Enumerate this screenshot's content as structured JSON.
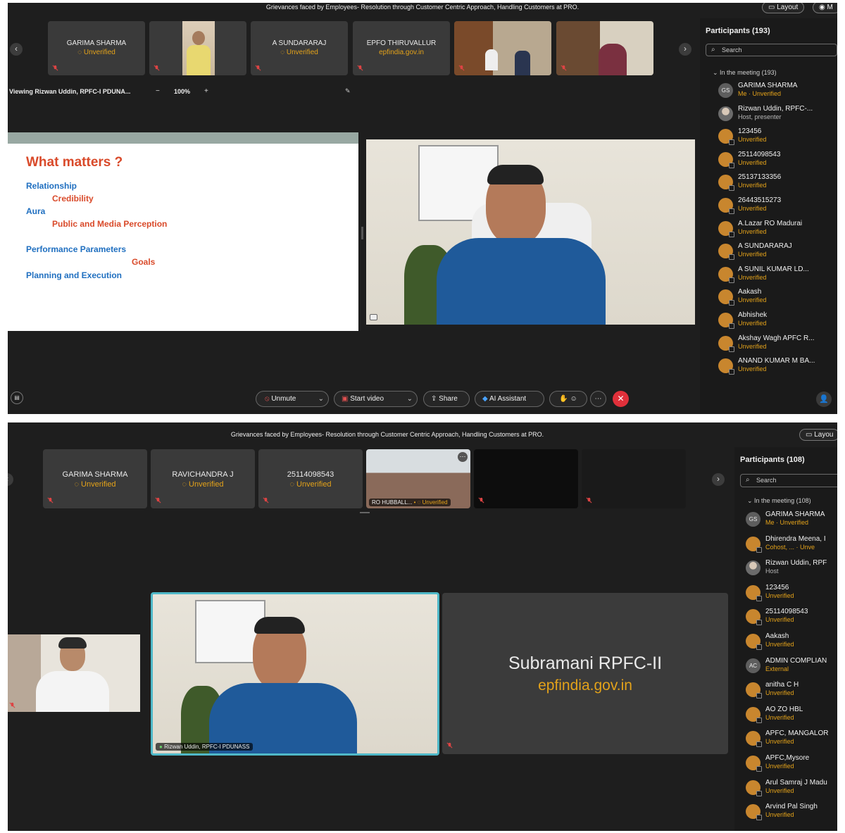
{
  "top": {
    "meeting_title": "Grievances faced by Employees- Resolution through Customer Centric Approach, Handling Customers at PRO.",
    "layout_label": "Layout",
    "tiles": [
      {
        "name": "GARIMA SHARMA",
        "sub": "Unverified"
      },
      {
        "name": "A SUNDARARAJ",
        "sub": "Unverified"
      },
      {
        "name": "EPFO THIRUVALLUR",
        "sub": "epfindia.gov.in"
      }
    ],
    "viewing_label": "Viewing Rizwan Uddin, RPFC-I PDUNA...",
    "zoom_minus": "−",
    "zoom_value": "100%",
    "zoom_plus": "+",
    "slide": {
      "heading": "What matters ?",
      "lines": [
        "Relationship",
        "Credibility",
        "Aura",
        "Public and Media Perception",
        "Performance Parameters",
        "Goals",
        "Planning and Execution"
      ]
    },
    "participants": {
      "title": "Participants (193)",
      "search_placeholder": "Search",
      "group_label": "In the meeting (193)",
      "list": [
        {
          "name": "GARIMA SHARMA",
          "sub": "Me · Unverified",
          "avatar": "GS"
        },
        {
          "name": "Rizwan Uddin, RPFC-...",
          "sub": "Host, presenter",
          "avatar": ""
        },
        {
          "name": "123456",
          "sub": "Unverified",
          "avatar": ""
        },
        {
          "name": "25114098543",
          "sub": "Unverified",
          "avatar": ""
        },
        {
          "name": "25137133356",
          "sub": "Unverified",
          "avatar": ""
        },
        {
          "name": "26443515273",
          "sub": "Unverified",
          "avatar": ""
        },
        {
          "name": "A.Lazar RO Madurai",
          "sub": "Unverified",
          "avatar": ""
        },
        {
          "name": "A SUNDARARAJ",
          "sub": "Unverified",
          "avatar": ""
        },
        {
          "name": "A SUNIL KUMAR LD...",
          "sub": "Unverified",
          "avatar": ""
        },
        {
          "name": "Aakash",
          "sub": "Unverified",
          "avatar": ""
        },
        {
          "name": "Abhishek",
          "sub": "Unverified",
          "avatar": ""
        },
        {
          "name": "Akshay Wagh APFC R...",
          "sub": "Unverified",
          "avatar": ""
        },
        {
          "name": "ANAND KUMAR M BA...",
          "sub": "Unverified",
          "avatar": ""
        }
      ]
    },
    "controls": {
      "unmute": "Unmute",
      "start_video": "Start video",
      "share": "Share",
      "ai_assistant": "AI Assistant"
    }
  },
  "bottom": {
    "meeting_title": "Grievances faced by Employees- Resolution through Customer Centric Approach, Handling Customers at PRO.",
    "layout_label": "Layou",
    "tiles": [
      {
        "name": "GARIMA SHARMA",
        "sub": "Unverified"
      },
      {
        "name": "RAVICHANDRA J",
        "sub": "Unverified"
      },
      {
        "name": "25114098543",
        "sub": "Unverified"
      }
    ],
    "ro_tile": {
      "name": "RO HUBBALL...",
      "sub": "Unverified"
    },
    "speaker_label": "Rizwan Uddin, RPFC-I PDUNASS",
    "big_tile": {
      "name": "Subramani RPFC-II",
      "sub": "epfindia.gov.in"
    },
    "participants": {
      "title": "Participants (108)",
      "search_placeholder": "Search",
      "group_label": "In the meeting (108)",
      "list": [
        {
          "name": "GARIMA SHARMA",
          "sub": "Me · Unverified",
          "avatar": "GS"
        },
        {
          "name": "Dhirendra Meena, I",
          "sub": "Cohost, ... · Unve",
          "avatar": ""
        },
        {
          "name": "Rizwan Uddin, RPF",
          "sub": "Host",
          "avatar": ""
        },
        {
          "name": "123456",
          "sub": "Unverified",
          "avatar": ""
        },
        {
          "name": "25114098543",
          "sub": "Unverified",
          "avatar": ""
        },
        {
          "name": "Aakash",
          "sub": "Unverified",
          "avatar": ""
        },
        {
          "name": "ADMIN COMPLIAN",
          "sub": "External",
          "avatar": "AC"
        },
        {
          "name": "anitha C H",
          "sub": "Unverified",
          "avatar": ""
        },
        {
          "name": "AO ZO HBL",
          "sub": "Unverified",
          "avatar": ""
        },
        {
          "name": "APFC, MANGALOR",
          "sub": "Unverified",
          "avatar": ""
        },
        {
          "name": "APFC,Mysore",
          "sub": "Unverified",
          "avatar": ""
        },
        {
          "name": "Arul Samraj J Madu",
          "sub": "Unverified",
          "avatar": ""
        },
        {
          "name": "Arvind Pal Singh",
          "sub": "Unverified",
          "avatar": ""
        }
      ]
    }
  }
}
